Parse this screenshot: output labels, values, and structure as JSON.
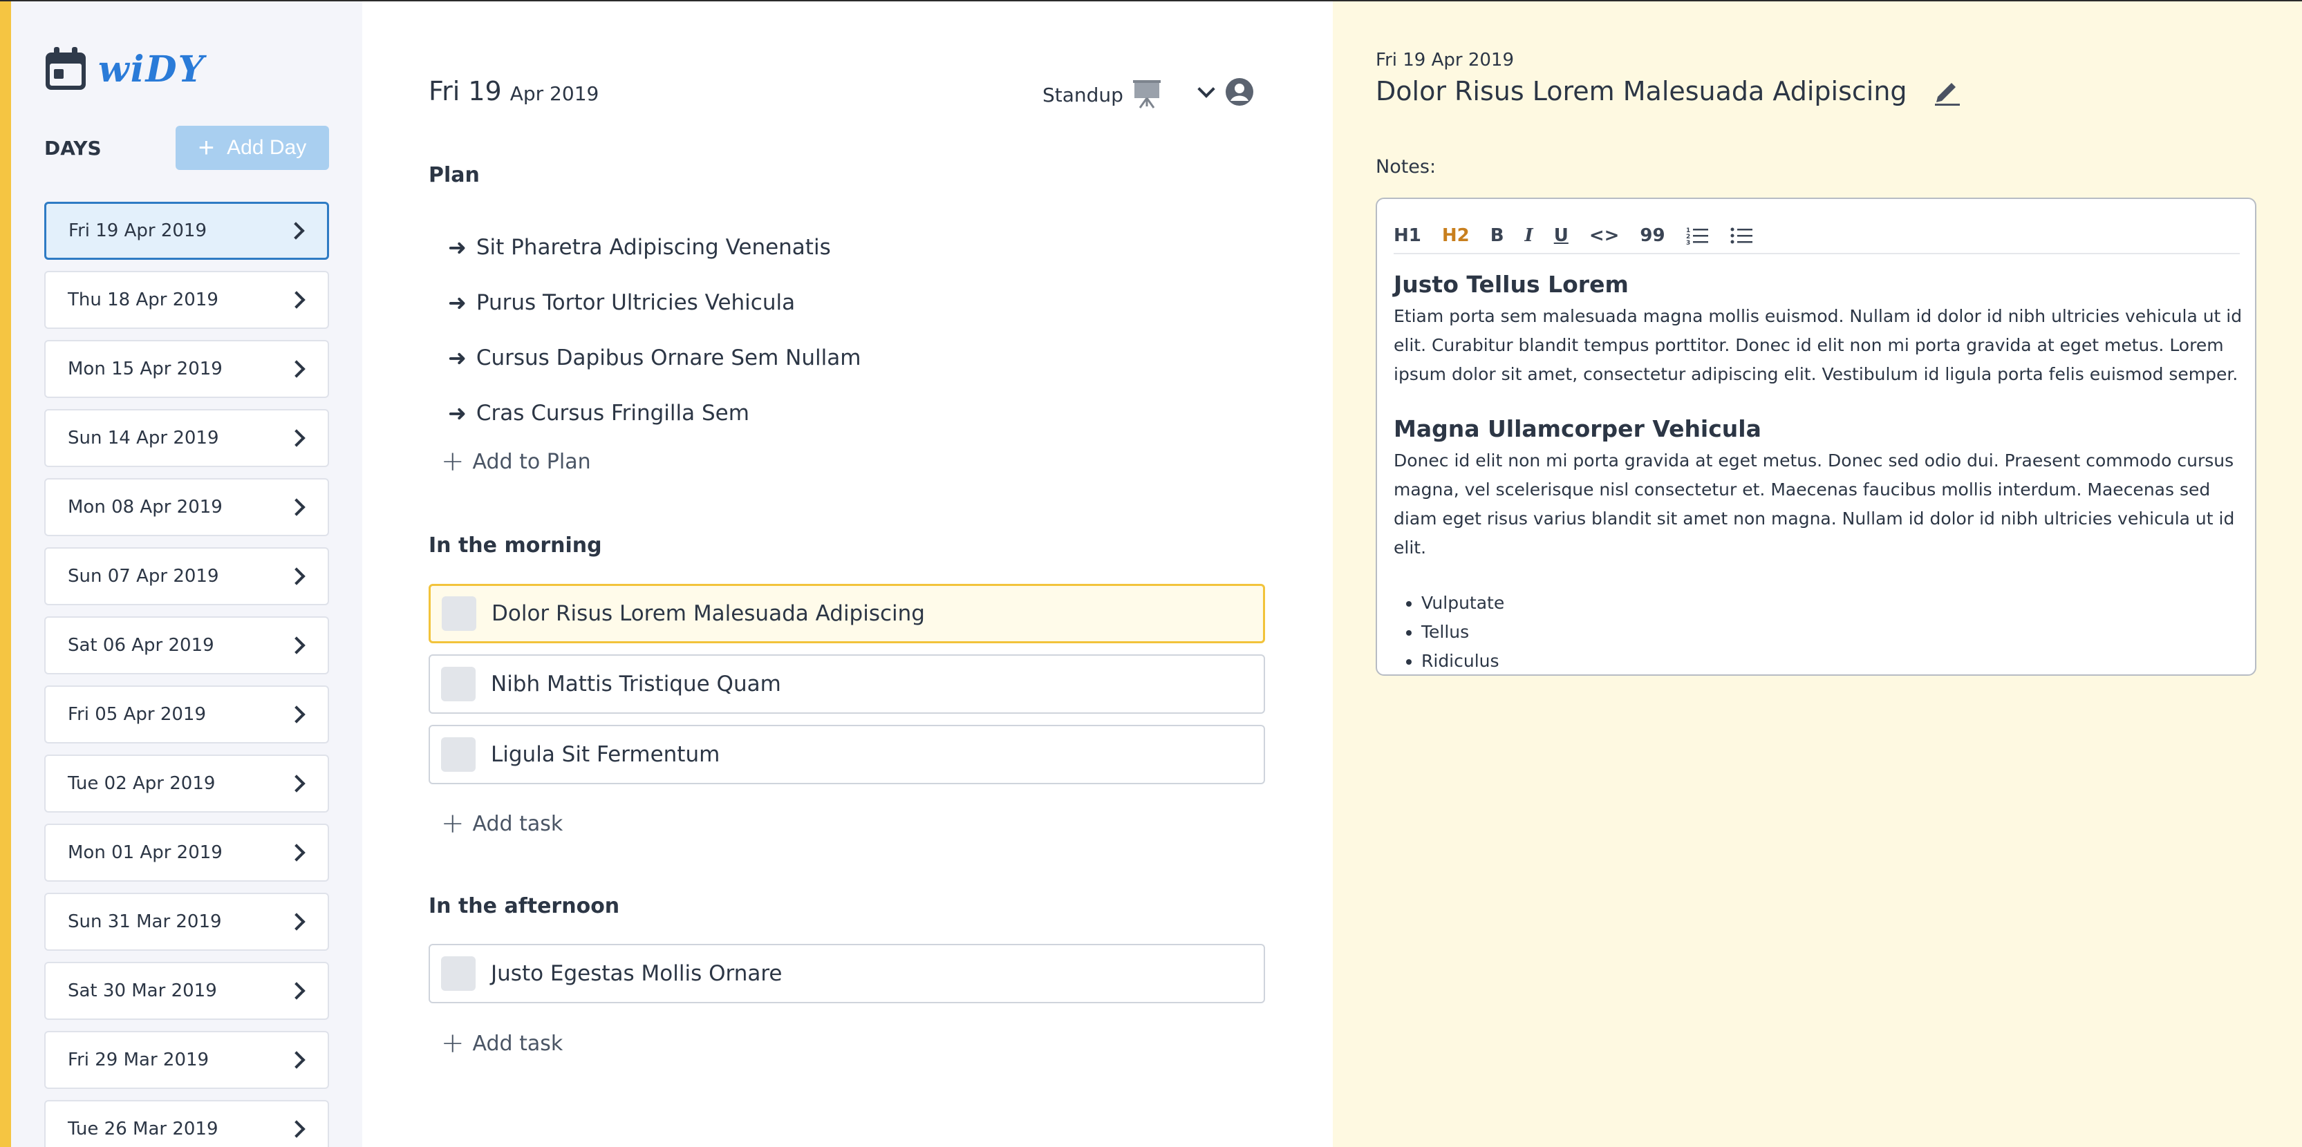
{
  "app": {
    "name": "wiDY"
  },
  "sidebar": {
    "days_label": "DAYS",
    "add_day_label": "Add Day",
    "days": [
      "Fri 19 Apr 2019",
      "Thu 18 Apr 2019",
      "Mon 15 Apr 2019",
      "Sun 14 Apr 2019",
      "Mon 08 Apr 2019",
      "Sun 07 Apr 2019",
      "Sat 06 Apr 2019",
      "Fri 05 Apr 2019",
      "Tue 02 Apr 2019",
      "Mon 01 Apr 2019",
      "Sun 31 Mar 2019",
      "Sat 30 Mar 2019",
      "Fri 29 Mar 2019",
      "Tue 26 Mar 2019"
    ],
    "active_index": 0
  },
  "day": {
    "day_big": "Fri 19",
    "day_small": "Apr 2019",
    "standup_label": "Standup",
    "plan": {
      "title": "Plan",
      "items": [
        "Sit Pharetra Adipiscing Venenatis",
        "Purus Tortor Ultricies Vehicula",
        "Cursus Dapibus Ornare Sem Nullam",
        "Cras Cursus Fringilla Sem"
      ],
      "add_label": "Add to Plan"
    },
    "morning": {
      "title": "In the morning",
      "tasks": [
        "Dolor Risus Lorem Malesuada Adipiscing",
        "Nibh Mattis Tristique Quam",
        "Ligula Sit Fermentum"
      ],
      "add_label": "Add task"
    },
    "afternoon": {
      "title": "In the afternoon",
      "tasks": [
        "Justo Egestas Mollis Ornare"
      ],
      "add_label": "Add task"
    }
  },
  "detail": {
    "date": "Fri 19 Apr 2019",
    "title": "Dolor Risus Lorem Malesuada Adipiscing",
    "notes_label": "Notes:",
    "toolbar": {
      "h1": "H1",
      "h2": "H2",
      "bold": "B",
      "italic": "I",
      "underline": "U",
      "code": "<>",
      "quote": "99"
    },
    "content": {
      "heading1": "Justo Tellus Lorem",
      "paragraph1": "Etiam porta sem malesuada magna mollis euismod. Nullam id dolor id nibh ultricies vehicula ut id elit. Curabitur blandit tempus porttitor. Donec id elit non mi porta gravida at eget metus. Lorem ipsum dolor sit amet, consectetur adipiscing elit. Vestibulum id ligula porta felis euismod semper.",
      "heading2": "Magna Ullamcorper Vehicula",
      "paragraph2": "Donec id elit non mi porta gravida at eget metus. Donec sed odio dui. Praesent commodo cursus magna, vel scelerisque nisl consectetur et. Maecenas faucibus mollis interdum. Maecenas sed diam eget risus varius blandit sit amet non magna. Nullam id dolor id nibh ultricies vehicula ut id elit.",
      "bullets": [
        "Vulputate",
        "Tellus",
        "Ridiculus"
      ]
    }
  },
  "colors": {
    "accent_yellow": "#f5c542",
    "brand_blue": "#2a7bd8",
    "active_day_border": "#2e7bc4",
    "active_task_border": "#f2c33b",
    "detail_background": "#fef9e1",
    "h2_button": "#c87f1e"
  }
}
